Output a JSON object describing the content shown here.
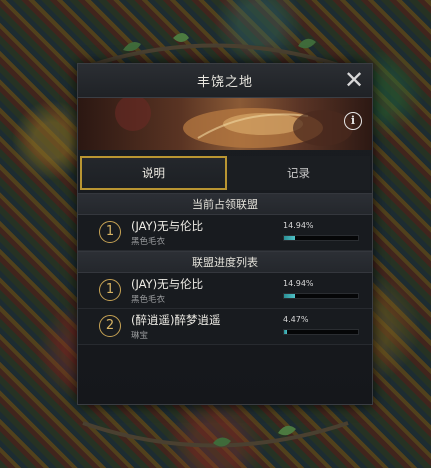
{
  "dialog": {
    "title": "丰饶之地",
    "close_icon": "close-icon",
    "info_icon": "info-icon",
    "info_glyph": "i"
  },
  "tabs": [
    {
      "label": "说明",
      "active": true
    },
    {
      "label": "记录",
      "active": false
    }
  ],
  "current": {
    "header": "当前占领联盟",
    "entries": [
      {
        "rank": "1",
        "name": "(JAY)无与伦比",
        "leader": "黑色毛衣",
        "percent": "14.94%",
        "progress": 0.1494
      }
    ]
  },
  "progress_list": {
    "header": "联盟进度列表",
    "entries": [
      {
        "rank": "1",
        "name": "(JAY)无与伦比",
        "leader": "黑色毛衣",
        "percent": "14.94%",
        "progress": 0.1494
      },
      {
        "rank": "2",
        "name": "(醉逍遥)醉梦逍遥",
        "leader": "琳宝",
        "percent": "4.47%",
        "progress": 0.0447
      }
    ]
  },
  "colors": {
    "accent_gold": "#b99532",
    "progress_fill": "#4fc2c7"
  }
}
